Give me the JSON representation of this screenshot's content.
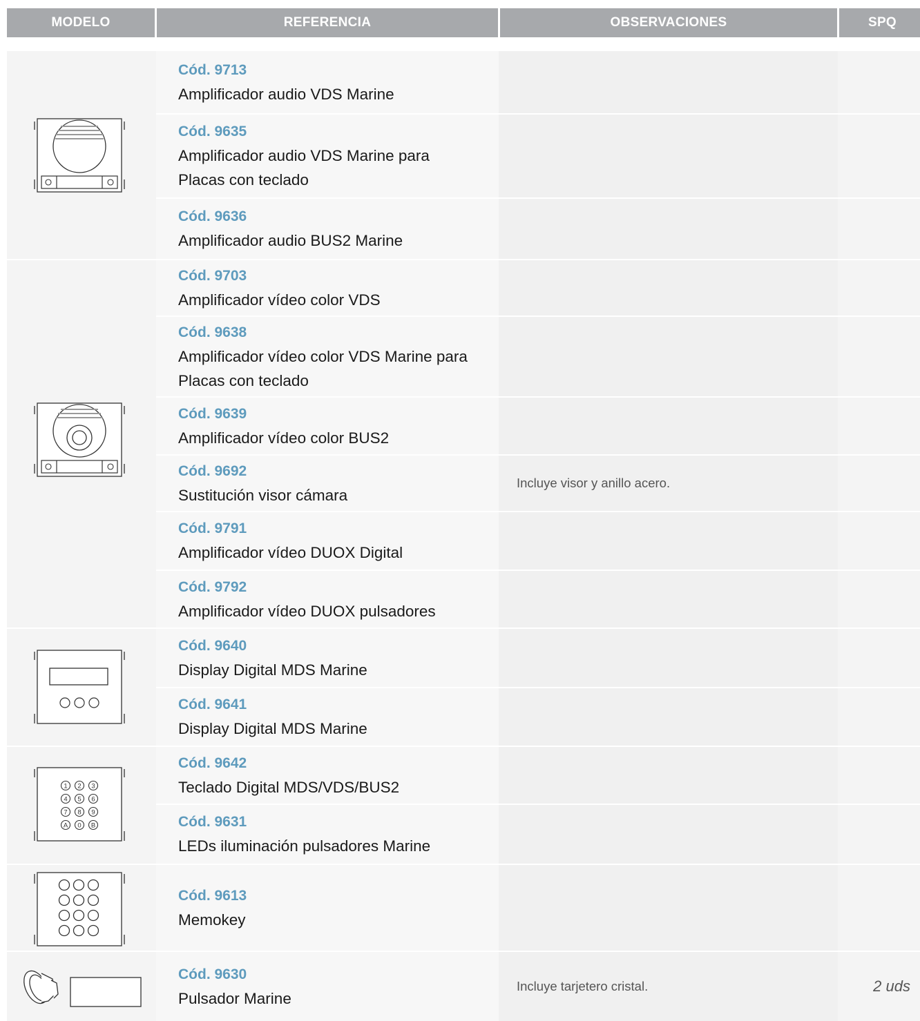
{
  "header": {
    "modelo": "MODELO",
    "referencia": "REFERENCIA",
    "observaciones": "OBSERVACIONES",
    "spq": "SPQ"
  },
  "groups": [
    {
      "icon": "audio-amplifier-panel-icon"
    },
    {
      "icon": "video-amplifier-panel-icon"
    },
    {
      "icon": "display-panel-icon"
    },
    {
      "icon": "digital-keypad-panel-icon"
    },
    {
      "icon": "memokey-panel-icon"
    },
    {
      "icon": "push-button-and-card-holder-icon"
    }
  ],
  "rows": [
    {
      "code": "Cód. 9713",
      "desc": "Amplificador audio VDS Marine",
      "obs": "",
      "spq": ""
    },
    {
      "code": "Cód. 9635",
      "desc": "Amplificador audio VDS Marine para Placas con teclado",
      "obs": "",
      "spq": ""
    },
    {
      "code": "Cód. 9636",
      "desc": "Amplificador audio BUS2 Marine",
      "obs": "",
      "spq": ""
    },
    {
      "code": "Cód. 9703",
      "desc": "Amplificador vídeo color VDS",
      "obs": "",
      "spq": ""
    },
    {
      "code": "Cód. 9638",
      "desc": "Amplificador vídeo color VDS Marine para Placas con teclado",
      "obs": "",
      "spq": ""
    },
    {
      "code": "Cód. 9639",
      "desc": "Amplificador vídeo color BUS2",
      "obs": "",
      "spq": ""
    },
    {
      "code": "Cód. 9692",
      "desc": "Sustitución visor cámara",
      "obs": "Incluye visor y anillo acero.",
      "spq": ""
    },
    {
      "code": "Cód. 9791",
      "desc": "Amplificador vídeo DUOX Digital",
      "obs": "",
      "spq": ""
    },
    {
      "code": "Cód. 9792",
      "desc": "Amplificador vídeo DUOX pulsadores",
      "obs": "",
      "spq": ""
    },
    {
      "code": "Cód. 9640",
      "desc": "Display Digital MDS Marine",
      "obs": "",
      "spq": ""
    },
    {
      "code": "Cód. 9641",
      "desc": "Display Digital MDS Marine",
      "obs": "",
      "spq": ""
    },
    {
      "code": "Cód. 9642",
      "desc": "Teclado Digital MDS/VDS/BUS2",
      "obs": "",
      "spq": ""
    },
    {
      "code": "Cód. 9631",
      "desc": "LEDs iluminación pulsadores Marine",
      "obs": "",
      "spq": ""
    },
    {
      "code": "Cód. 9613",
      "desc": "Memokey",
      "obs": "",
      "spq": ""
    },
    {
      "code": "Cód. 9630",
      "desc": "Pulsador Marine",
      "obs": "Incluye tarjetero cristal.",
      "spq": "2 uds"
    }
  ],
  "keypad_labels": [
    "1",
    "2",
    "3",
    "4",
    "5",
    "6",
    "7",
    "8",
    "9",
    "A",
    "0",
    "B"
  ]
}
